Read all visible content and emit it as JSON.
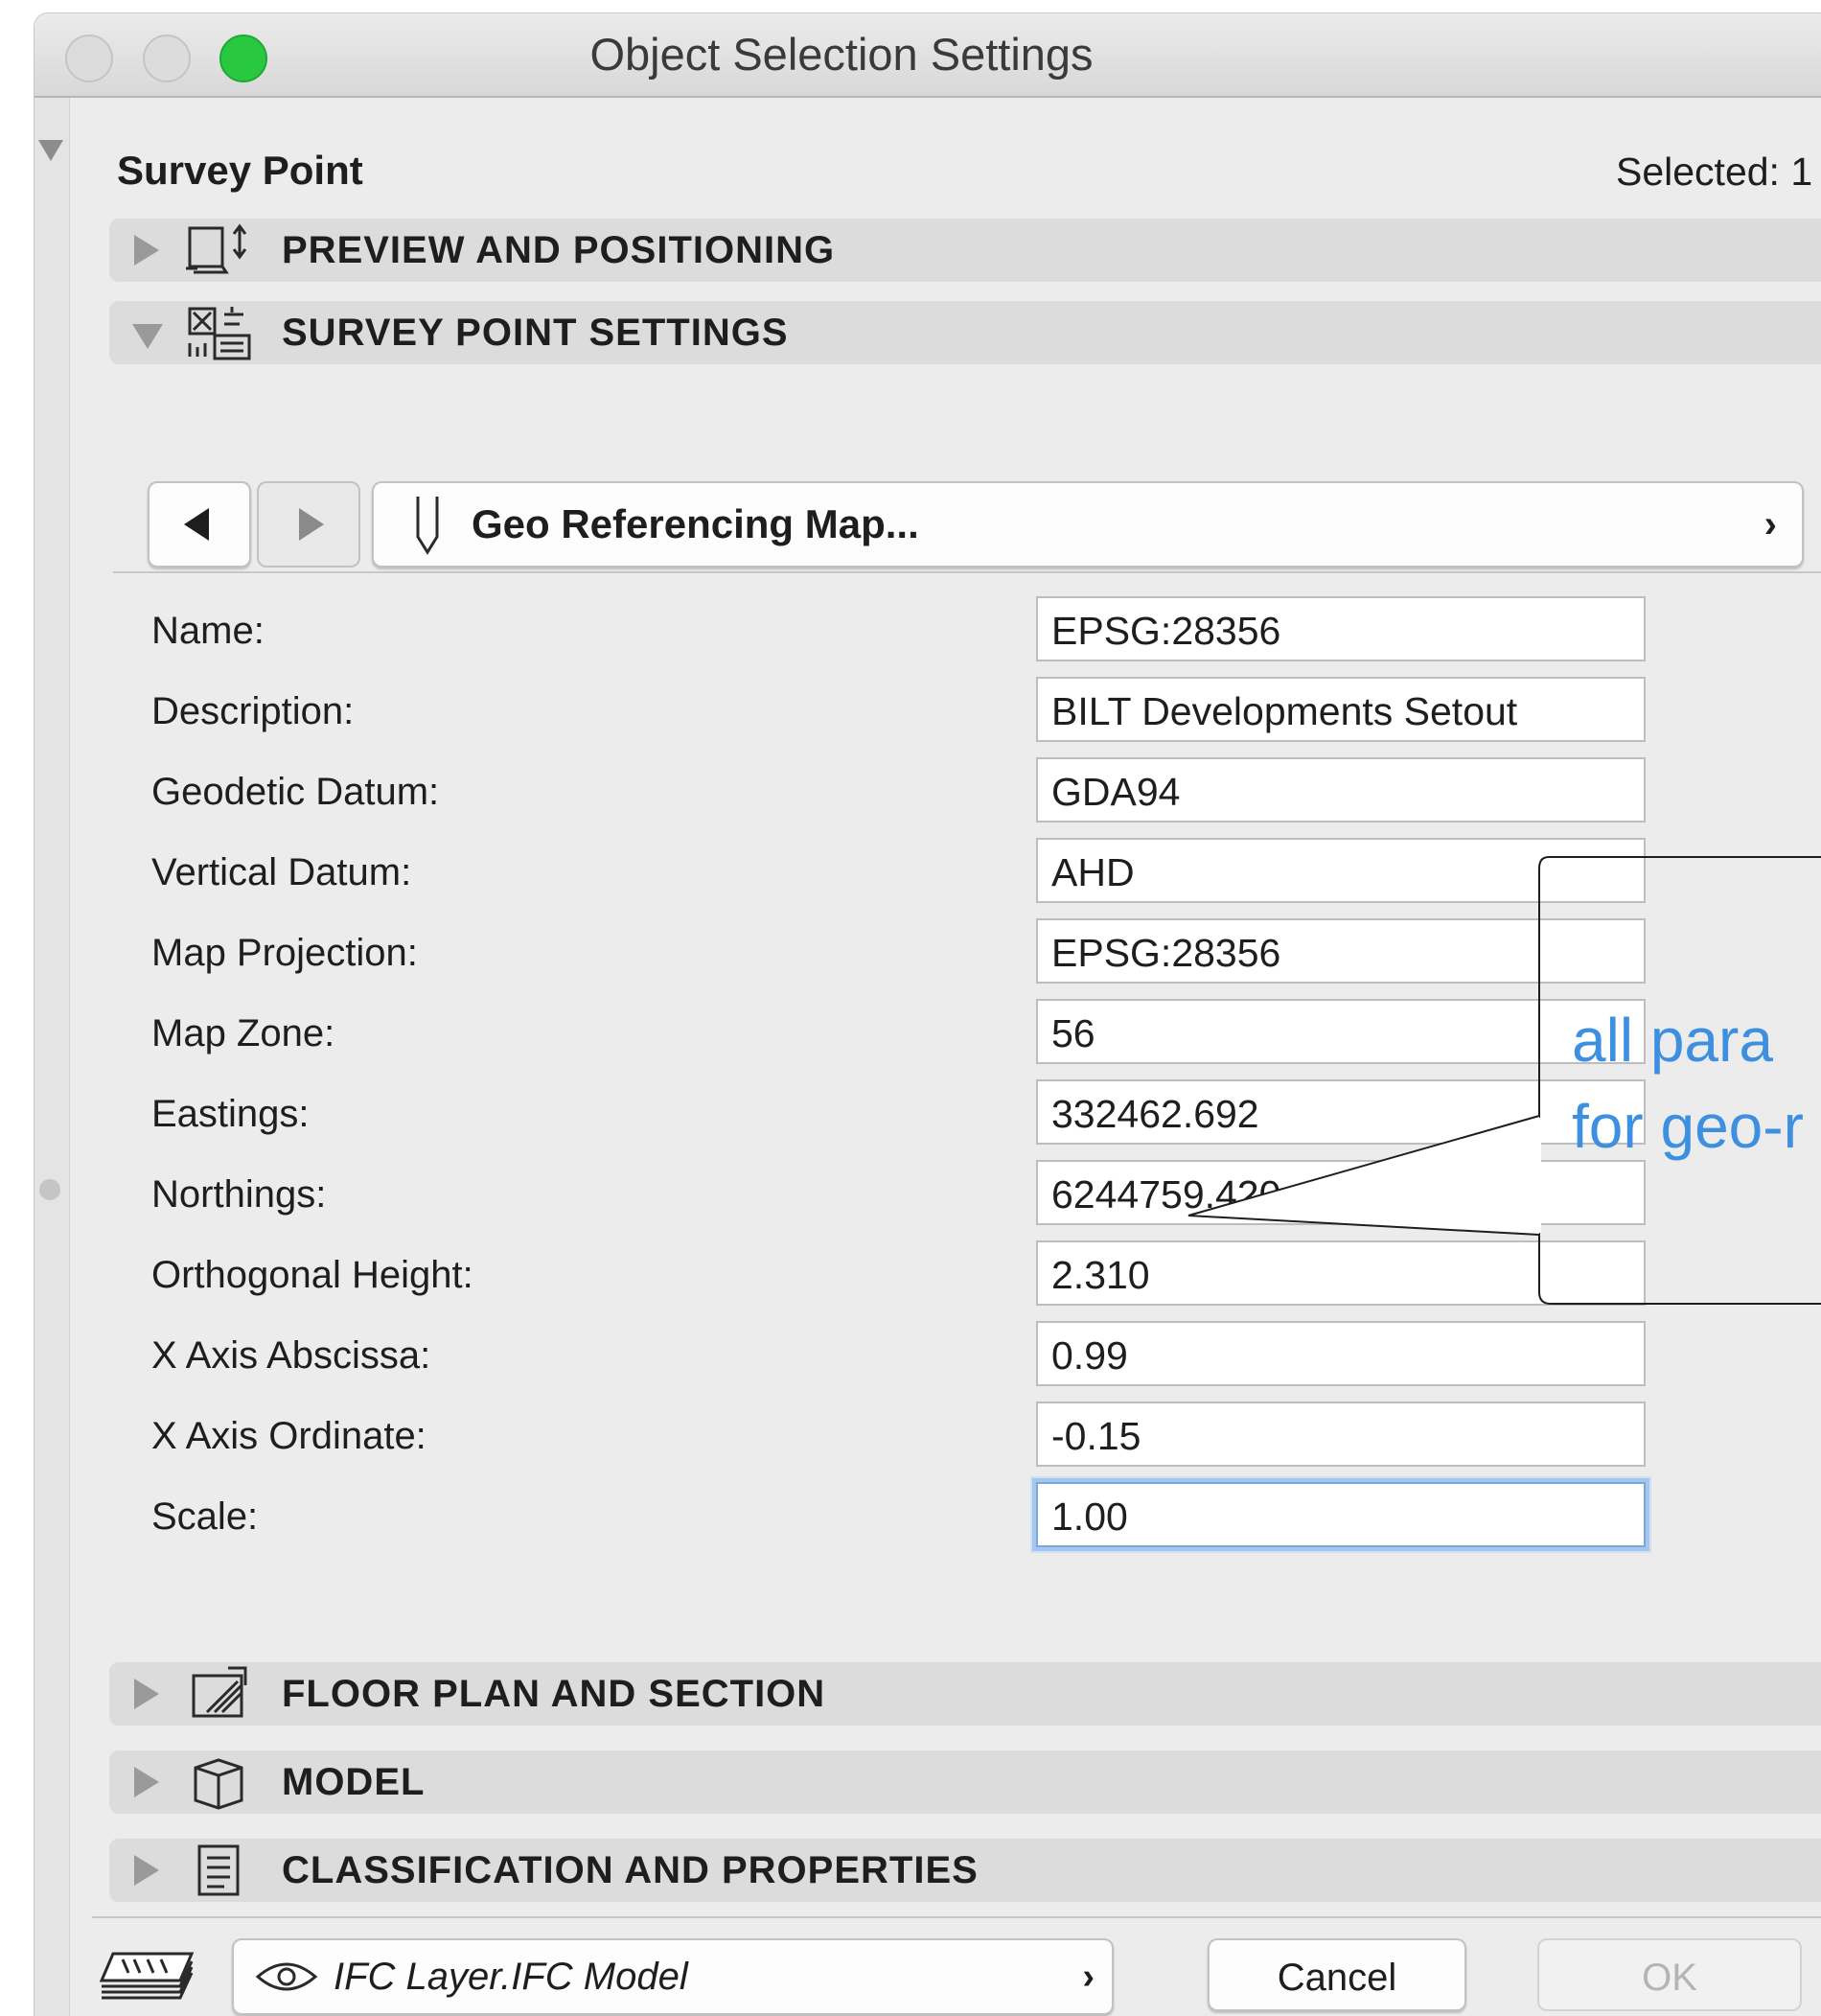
{
  "window": {
    "title": "Object Selection Settings"
  },
  "header": {
    "object_type": "Survey Point",
    "selected_label": "Selected: 1"
  },
  "sections": {
    "preview_positioning": "PREVIEW AND POSITIONING",
    "survey_point_settings": "SURVEY POINT SETTINGS",
    "floor_plan_section": "FLOOR PLAN AND SECTION",
    "model": "MODEL",
    "classification_properties": "CLASSIFICATION AND PROPERTIES"
  },
  "page_selector": {
    "current_page": "Geo Referencing Map...",
    "chevron": "›"
  },
  "fields": [
    {
      "label": "Name:",
      "value": "EPSG:28356"
    },
    {
      "label": "Description:",
      "value": "BILT Developments Setout"
    },
    {
      "label": "Geodetic Datum:",
      "value": "GDA94"
    },
    {
      "label": "Vertical Datum:",
      "value": "AHD"
    },
    {
      "label": "Map Projection:",
      "value": "EPSG:28356"
    },
    {
      "label": "Map Zone:",
      "value": "56"
    },
    {
      "label": "Eastings:",
      "value": "332462.692"
    },
    {
      "label": "Northings:",
      "value": "6244759.420"
    },
    {
      "label": "Orthogonal Height:",
      "value": "2.310"
    },
    {
      "label": "X Axis Abscissa:",
      "value": "0.99"
    },
    {
      "label": "X Axis Ordinate:",
      "value": "-0.15"
    },
    {
      "label": "Scale:",
      "value": "1.00"
    }
  ],
  "footer": {
    "layer": "IFC Layer.IFC Model",
    "layer_chevron": "›",
    "cancel_label": "Cancel",
    "ok_label": "OK"
  },
  "annotation": {
    "line1": "all para",
    "line2": "for geo-r"
  },
  "colors": {
    "accent_green": "#28c840",
    "focus_ring": "#a7c6ee",
    "annotation_text": "#3d8fe0"
  }
}
